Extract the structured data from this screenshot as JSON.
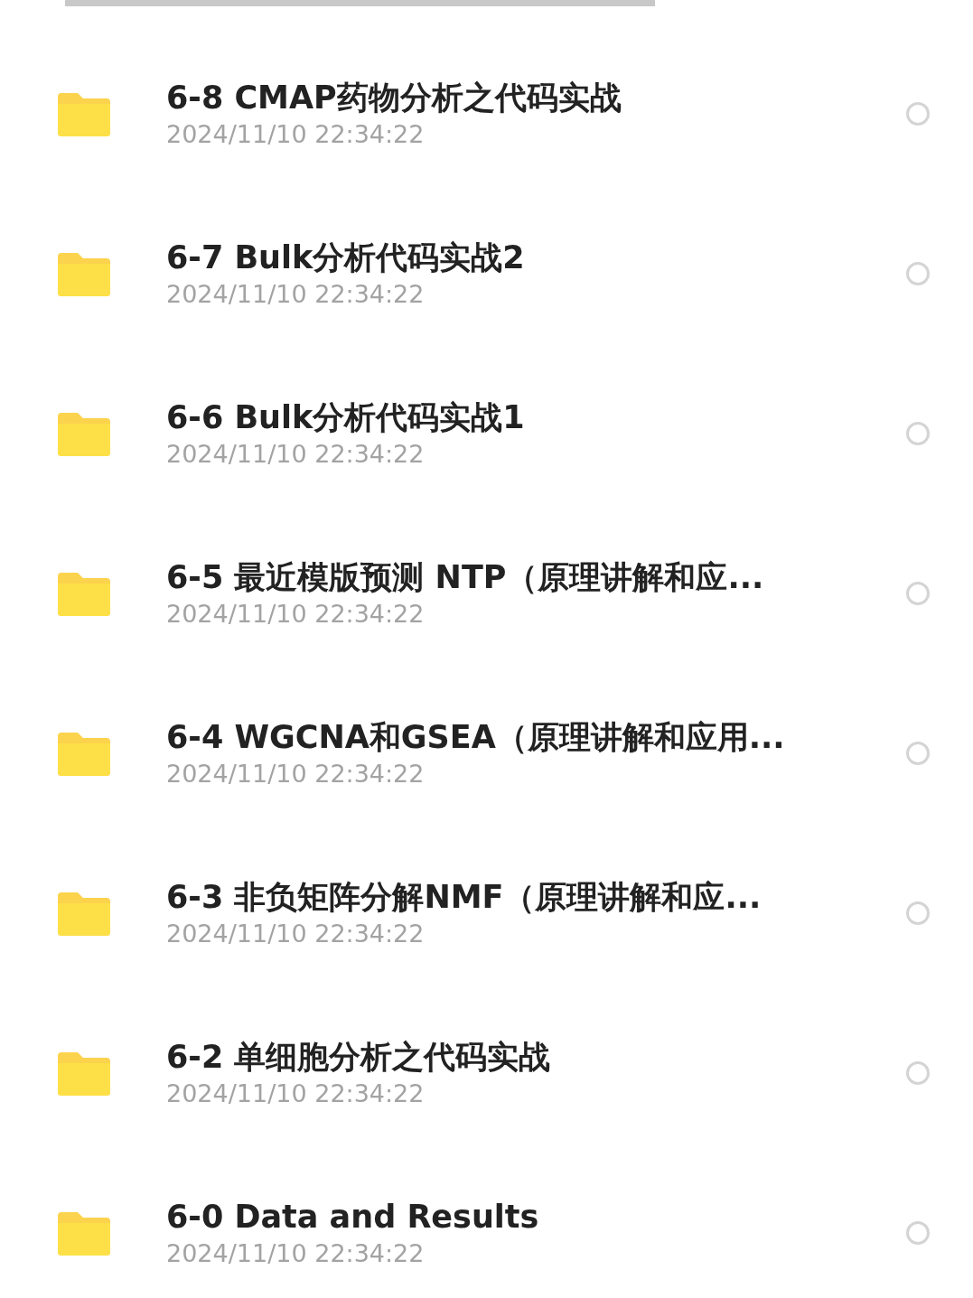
{
  "folders": [
    {
      "name": "6-8 CMAP药物分析之代码实战",
      "date": "2024/11/10 22:34:22",
      "selected": false
    },
    {
      "name": "6-7 Bulk分析代码实战2",
      "date": "2024/11/10 22:34:22",
      "selected": false
    },
    {
      "name": "6-6 Bulk分析代码实战1",
      "date": "2024/11/10 22:34:22",
      "selected": false
    },
    {
      "name": "6-5 最近模版预测 NTP（原理讲解和应...",
      "date": "2024/11/10 22:34:22",
      "selected": false
    },
    {
      "name": "6-4 WGCNA和GSEA（原理讲解和应用...",
      "date": "2024/11/10 22:34:22",
      "selected": false
    },
    {
      "name": "6-3 非负矩阵分解NMF（原理讲解和应...",
      "date": "2024/11/10 22:34:22",
      "selected": false
    },
    {
      "name": "6-2 单细胞分析之代码实战",
      "date": "2024/11/10 22:34:22",
      "selected": false
    },
    {
      "name": "6-0 Data and Results",
      "date": "2024/11/10 22:34:22",
      "selected": false
    }
  ]
}
